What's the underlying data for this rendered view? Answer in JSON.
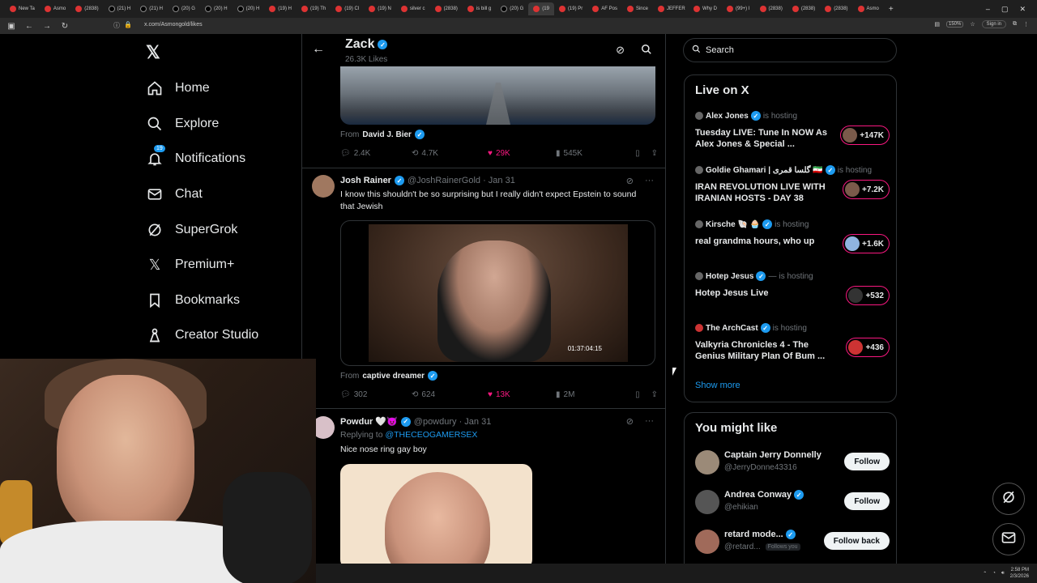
{
  "browser": {
    "tabs": [
      "New Ta",
      "Asmo",
      "(2838)",
      "(21) H",
      "(21) H",
      "(20) G",
      "(20) H",
      "(20) H",
      "(19) H",
      "(19) Th",
      "(19) Cl",
      "(19) N",
      "silver c",
      "(2838)",
      "is bill g",
      "(20) G",
      "(19",
      "(19) Pr",
      "AF Pos",
      "Since",
      "JEFFER",
      "Why D",
      "(99+) I",
      "(2838)",
      "(2838)",
      "(2838)",
      "Asmo"
    ],
    "url": "x.com/Asmongold/likes",
    "zoom": "150%",
    "sign_in": "Sign in"
  },
  "nav": {
    "items": [
      {
        "label": "Home",
        "icon": "home-icon"
      },
      {
        "label": "Explore",
        "icon": "search-icon"
      },
      {
        "label": "Notifications",
        "icon": "bell-icon",
        "badge": "19"
      },
      {
        "label": "Chat",
        "icon": "mail-icon"
      },
      {
        "label": "SuperGrok",
        "icon": "grok-icon"
      },
      {
        "label": "Premium+",
        "icon": "x-icon"
      },
      {
        "label": "Bookmarks",
        "icon": "bookmark-icon"
      },
      {
        "label": "Creator Studio",
        "icon": "studio-icon"
      }
    ]
  },
  "header": {
    "name": "Zack",
    "likes": "26.3K Likes"
  },
  "posts": [
    {
      "from_label": "From",
      "from_name": "David J. Bier",
      "replies": "2.4K",
      "reposts": "4.7K",
      "likes": "29K",
      "views": "545K"
    },
    {
      "name": "Josh Rainer",
      "handle": "@JoshRainerGold · Jan 31",
      "text": "I know this shouldn't be so surprising but I really didn't expect Epstein to sound that Jewish",
      "timestamp": "01:37:04:15",
      "from_label": "From",
      "from_name": "captive dreamer",
      "replies": "302",
      "reposts": "624",
      "likes": "13K",
      "views": "2M"
    },
    {
      "name": "Powdur 🤍😈",
      "handle": "@powdury · Jan 31",
      "replying_label": "Replying to",
      "replying_to": "@THECEOGAMERSEX",
      "text": "Nice nose ring gay boy"
    }
  ],
  "search": {
    "placeholder": "Search"
  },
  "live": {
    "title": "Live on X",
    "hosting_label": "is hosting",
    "items": [
      {
        "host": "Alex Jones",
        "title": "Tuesday LIVE: Tune In NOW As Alex Jones & Special ...",
        "count": "+147K"
      },
      {
        "host": "Goldie Ghamari | گلسا قمری 🇮🇷",
        "title": "IRAN REVOLUTION LIVE WITH IRANIAN HOSTS - DAY 38",
        "count": "+7.2K"
      },
      {
        "host": "Kirsche 🐚 🧁",
        "title": "real grandma hours, who up",
        "count": "+1.6K"
      },
      {
        "host": "Hotep Jesus",
        "title": "Hotep Jesus Live",
        "count": "+532"
      },
      {
        "host": "The ArchCast",
        "title": "Valkyria Chronicles 4 - The Genius Military Plan Of Bum ...",
        "count": "+436"
      }
    ],
    "show_more": "Show more"
  },
  "suggest": {
    "title": "You might like",
    "items": [
      {
        "name": "Captain Jerry Donnelly",
        "handle": "@JerryDonne43316",
        "button": "Follow"
      },
      {
        "name": "Andrea Conway",
        "handle": "@ehikian",
        "button": "Follow"
      },
      {
        "name": "retard mode...",
        "handle": "@retard...",
        "follows_you": "Follows you",
        "button": "Follow back"
      }
    ]
  },
  "taskbar": {
    "time": "2:58 PM",
    "date": "2/3/2026"
  },
  "colors": {
    "accent": "#1d9bf0",
    "like": "#f91880",
    "bg": "#000000",
    "muted": "#71767b",
    "border": "#2f3336"
  }
}
